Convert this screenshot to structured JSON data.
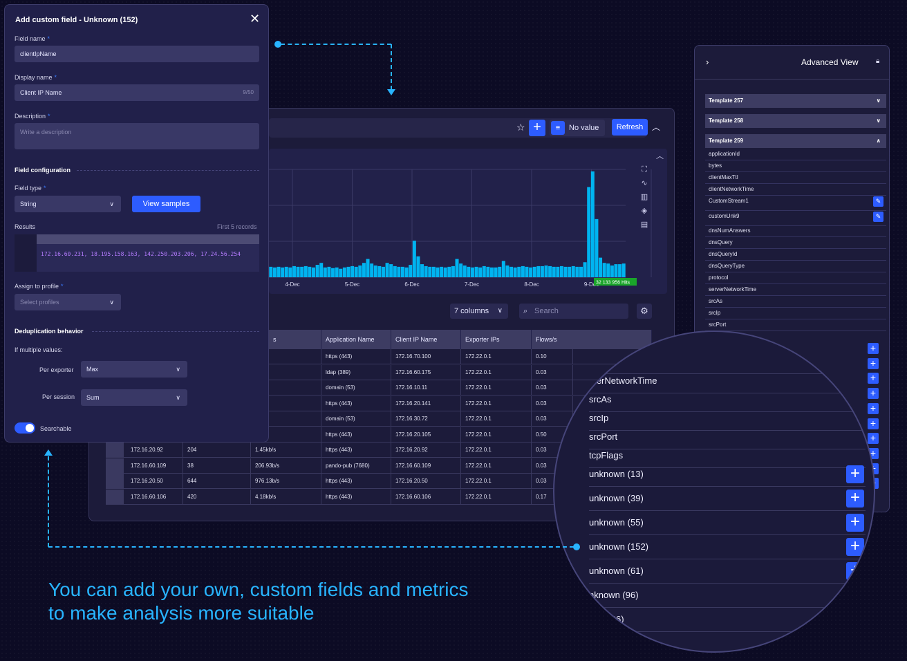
{
  "colors": {
    "accent": "#2d5cff",
    "connector": "#28b4ff",
    "bar": "#00b4f0",
    "hits_badge": "#1aa52a",
    "mono_text": "#b57cff"
  },
  "dashboard": {
    "no_value_label": "No value",
    "refresh_label": "Refresh",
    "hits_badge": "32 133 956 Hits",
    "columns_label": "7 columns",
    "search_placeholder": "Search",
    "table": {
      "headers": [
        "s",
        "Application Name",
        "Client IP Name",
        "Exporter IPs",
        "Flows/s"
      ],
      "rows": [
        [
          "",
          "",
          "0b/s",
          "https (443)",
          "172.16.70.100",
          "172.22.0.1",
          "0.10"
        ],
        [
          "",
          "",
          "b/s",
          "ldap (389)",
          "172.16.60.175",
          "172.22.0.1",
          "0.03"
        ],
        [
          "",
          "",
          "b/s",
          "domain (53)",
          "172.16.10.11",
          "172.22.0.1",
          "0.03"
        ],
        [
          "",
          "",
          "/s",
          "https (443)",
          "172.16.20.141",
          "172.22.0.1",
          "0.03"
        ],
        [
          "",
          "",
          "b/s",
          "domain (53)",
          "172.16.30.72",
          "172.22.0.1",
          "0.03"
        ],
        [
          "",
          "",
          "b/s",
          "https (443)",
          "172.16.20.105",
          "172.22.0.1",
          "0.50"
        ],
        [
          "172.16.20.92",
          "204",
          "1.45kb/s",
          "https (443)",
          "172.16.20.92",
          "172.22.0.1",
          "0.03"
        ],
        [
          "172.16.60.109",
          "38",
          "206.93b/s",
          "pando-pub (7680)",
          "172.16.60.109",
          "172.22.0.1",
          "0.03"
        ],
        [
          "172.16.20.50",
          "644",
          "976.13b/s",
          "https (443)",
          "172.16.20.50",
          "172.22.0.1",
          "0.03"
        ],
        [
          "172.16.60.106",
          "420",
          "4.18kb/s",
          "https (443)",
          "172.16.60.106",
          "172.22.0.1",
          "0.17"
        ]
      ]
    }
  },
  "chart_data": {
    "type": "bar",
    "x_ticks": [
      "4-Dec",
      "5-Dec",
      "6-Dec",
      "7-Dec",
      "8-Dec",
      "9-Dec"
    ],
    "values": [
      16,
      15,
      16,
      15,
      16,
      15,
      17,
      16,
      16,
      17,
      16,
      15,
      19,
      22,
      15,
      16,
      14,
      15,
      13,
      15,
      16,
      17,
      16,
      18,
      22,
      28,
      21,
      18,
      17,
      16,
      22,
      20,
      17,
      16,
      16,
      15,
      19,
      56,
      32,
      20,
      17,
      16,
      16,
      15,
      16,
      15,
      16,
      17,
      28,
      21,
      18,
      16,
      15,
      16,
      15,
      17,
      16,
      15,
      15,
      16,
      25,
      18,
      16,
      15,
      16,
      17,
      16,
      15,
      16,
      17,
      17,
      18,
      17,
      16,
      16,
      17,
      16,
      16,
      17,
      16,
      16,
      23,
      138,
      162,
      89,
      30,
      22,
      21,
      18,
      20,
      20,
      21
    ],
    "grid": true
  },
  "modal": {
    "title": "Add custom field - Unknown (152)",
    "field_name_label": "Field name",
    "field_name_value": "clientIpName",
    "display_name_label": "Display name",
    "display_name_value": "Client IP Name",
    "display_name_counter": "9/50",
    "description_label": "Description",
    "description_placeholder": "Write a description",
    "field_config_heading": "Field configuration",
    "field_type_label": "Field type",
    "field_type_value": "String",
    "view_samples_label": "View samples",
    "results_label": "Results",
    "results_hint": "First 5 records",
    "results_sample": "172.16.60.231, 18.195.158.163, 142.250.203.206, 17.24.56.254",
    "assign_profile_label": "Assign to profile",
    "assign_profile_placeholder": "Select profiles",
    "dedup_heading": "Deduplication behavior",
    "multiple_values_label": "If multiple values:",
    "per_exporter_label": "Per exporter",
    "per_exporter_value": "Max",
    "per_session_label": "Per session",
    "per_session_value": "Sum",
    "searchable_label": "Searchable"
  },
  "advanced": {
    "title": "Advanced View",
    "templates": [
      {
        "label": "Template 257",
        "expanded": false
      },
      {
        "label": "Template 258",
        "expanded": false
      },
      {
        "label": "Template 259",
        "expanded": true
      }
    ],
    "fields": [
      "applicationId",
      "bytes",
      "clientMaxTtl",
      "clientNetworkTime",
      "CustomStream1",
      "customUnk9",
      "dnsNumAnswers",
      "dnsQuery",
      "dnsQueryId",
      "dnsQueryType",
      "protocol",
      "serverNetworkTime",
      "srcAs",
      "srcIp",
      "srcPort"
    ]
  },
  "magnifier": {
    "items": [
      "ol",
      "rverNetworkTime",
      "srcAs",
      "srcIp",
      "srcPort",
      "tcpFlags",
      "unknown (13)",
      "unknown (39)",
      "unknown (55)",
      "unknown (152)",
      "unknown (61)",
      "nknown (96)",
      "wn (136)"
    ]
  },
  "headline": {
    "line1": "You can add your own, custom fields and metrics",
    "line2": "to make analysis more suitable"
  }
}
